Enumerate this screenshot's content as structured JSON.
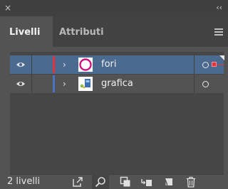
{
  "panel": {
    "close_glyph": "×",
    "collapse_glyph": "‹‹",
    "tabs": [
      {
        "label": "Livelli",
        "active": true
      },
      {
        "label": "Attributi",
        "active": false
      }
    ],
    "menu_icon": "hamburger-menu-icon"
  },
  "layers": [
    {
      "name": "fori",
      "color": "#e2343c",
      "visible": true,
      "selected": true,
      "thumbnail": "magenta-ring"
    },
    {
      "name": "grafica",
      "color": "#4a73c7",
      "visible": true,
      "selected": false,
      "thumbnail": "graphic-preview"
    }
  ],
  "colors": {
    "panel_bg": "#535353",
    "selected_row": "#4b6a8f",
    "accent_magenta": "#d0127f"
  },
  "footer": {
    "layer_count": "2 livelli",
    "buttons": [
      "export-icon",
      "search-icon",
      "clipping-mask-icon",
      "new-sublayer-icon",
      "new-layer-icon",
      "delete-icon"
    ]
  }
}
